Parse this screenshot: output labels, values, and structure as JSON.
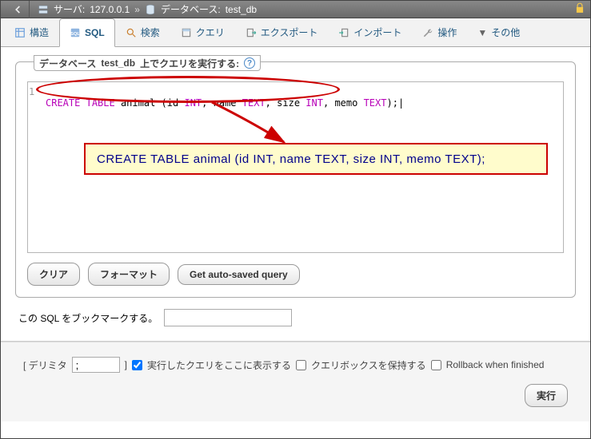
{
  "breadcrumb": {
    "server_label": "サーバ:",
    "server_value": "127.0.0.1",
    "database_label": "データベース:",
    "database_value": "test_db"
  },
  "tabs": {
    "structure": "構造",
    "sql": "SQL",
    "search": "検索",
    "query": "クエリ",
    "export": "エクスポート",
    "import": "インポート",
    "operations": "操作",
    "more": "その他"
  },
  "panel": {
    "legend_prefix": "データベース",
    "legend_db": "test_db",
    "legend_suffix": "上でクエリを実行する:"
  },
  "editor": {
    "line_no": "1",
    "kw_create": "CREATE",
    "kw_table": "TABLE",
    "tbl_name": "animal",
    "paren_open": "(",
    "col1": "id",
    "ty_int1": "INT",
    "c1": ",",
    "col2": "name",
    "ty_text1": "TEXT",
    "c2": ",",
    "col3": "size",
    "ty_int2": "INT",
    "c3": ",",
    "col4": "memo",
    "ty_text2": "TEXT",
    "paren_close": ");"
  },
  "callout_text": "CREATE TABLE animal (id INT, name TEXT, size INT, memo TEXT);",
  "buttons": {
    "clear": "クリア",
    "format": "フォーマット",
    "autosaved": "Get auto-saved query",
    "execute": "実行"
  },
  "bookmark_label": "この SQL をブックマークする。",
  "options": {
    "delimiter_open": "[ デリミタ",
    "delimiter_value": ";",
    "delimiter_close": "]",
    "show_query": "実行したクエリをここに表示する",
    "retain_box": "クエリボックスを保持する",
    "rollback": "Rollback when finished"
  }
}
